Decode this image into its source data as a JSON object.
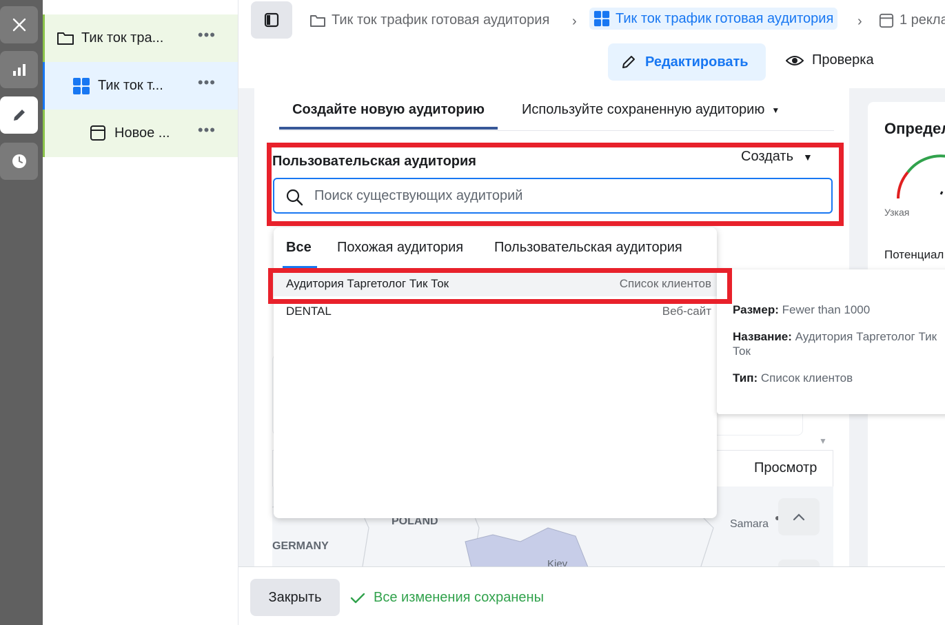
{
  "tree": {
    "items": [
      {
        "label": "Тик ток тра...",
        "icon": "folder-icon",
        "accent": "#8bc34a"
      },
      {
        "label": "Тик ток т...",
        "icon": "adset-grid-icon",
        "accent": "#1877f2"
      },
      {
        "label": "Новое ...",
        "icon": "ad-frame-icon",
        "accent": "#8bc34a"
      }
    ],
    "more": "•••"
  },
  "breadcrumbs": {
    "campaign": "Тик ток трафик готовая аудитория",
    "adset": "Тик ток трафик готовая аудитория",
    "ads": "1 рекла"
  },
  "topbar": {
    "edit_label": "Редактировать",
    "review_label": "Проверка"
  },
  "audience": {
    "tab_new": "Создайте новую аудиторию",
    "tab_saved": "Используйте сохраненную аудиторию",
    "custom_label": "Пользовательская аудитория",
    "create_label": "Создать",
    "search_placeholder": "Поиск существующих аудиторий",
    "preview_label": "Просмотр"
  },
  "dropdown": {
    "tabs": [
      "Все",
      "Похожая аудитория",
      "Пользовательская аудитория"
    ],
    "rows": [
      {
        "name": "Аудитория Таргетолог Тик Ток",
        "type": "Список клиентов"
      },
      {
        "name": "DENTAL",
        "type": "Веб-сайт"
      }
    ]
  },
  "tooltip": {
    "size_label": "Размер:",
    "size_value": "Fewer than 1000",
    "name_label": "Название:",
    "name_value": "Аудитория Таргетолог Тик Ток",
    "type_label": "Тип:",
    "type_value": "Список клиентов"
  },
  "map": {
    "labels": [
      "POLAND",
      "GERMANY",
      "Kiev",
      "Samara"
    ]
  },
  "right_panel": {
    "title": "Определ",
    "narrow": "Узкая",
    "potential": "Потенциал"
  },
  "bottom": {
    "close_label": "Закрыть",
    "saved_text": "Все изменения сохранены"
  },
  "colors": {
    "accent": "#1877f2",
    "highlight": "#e8212b",
    "success": "#31a24c"
  }
}
